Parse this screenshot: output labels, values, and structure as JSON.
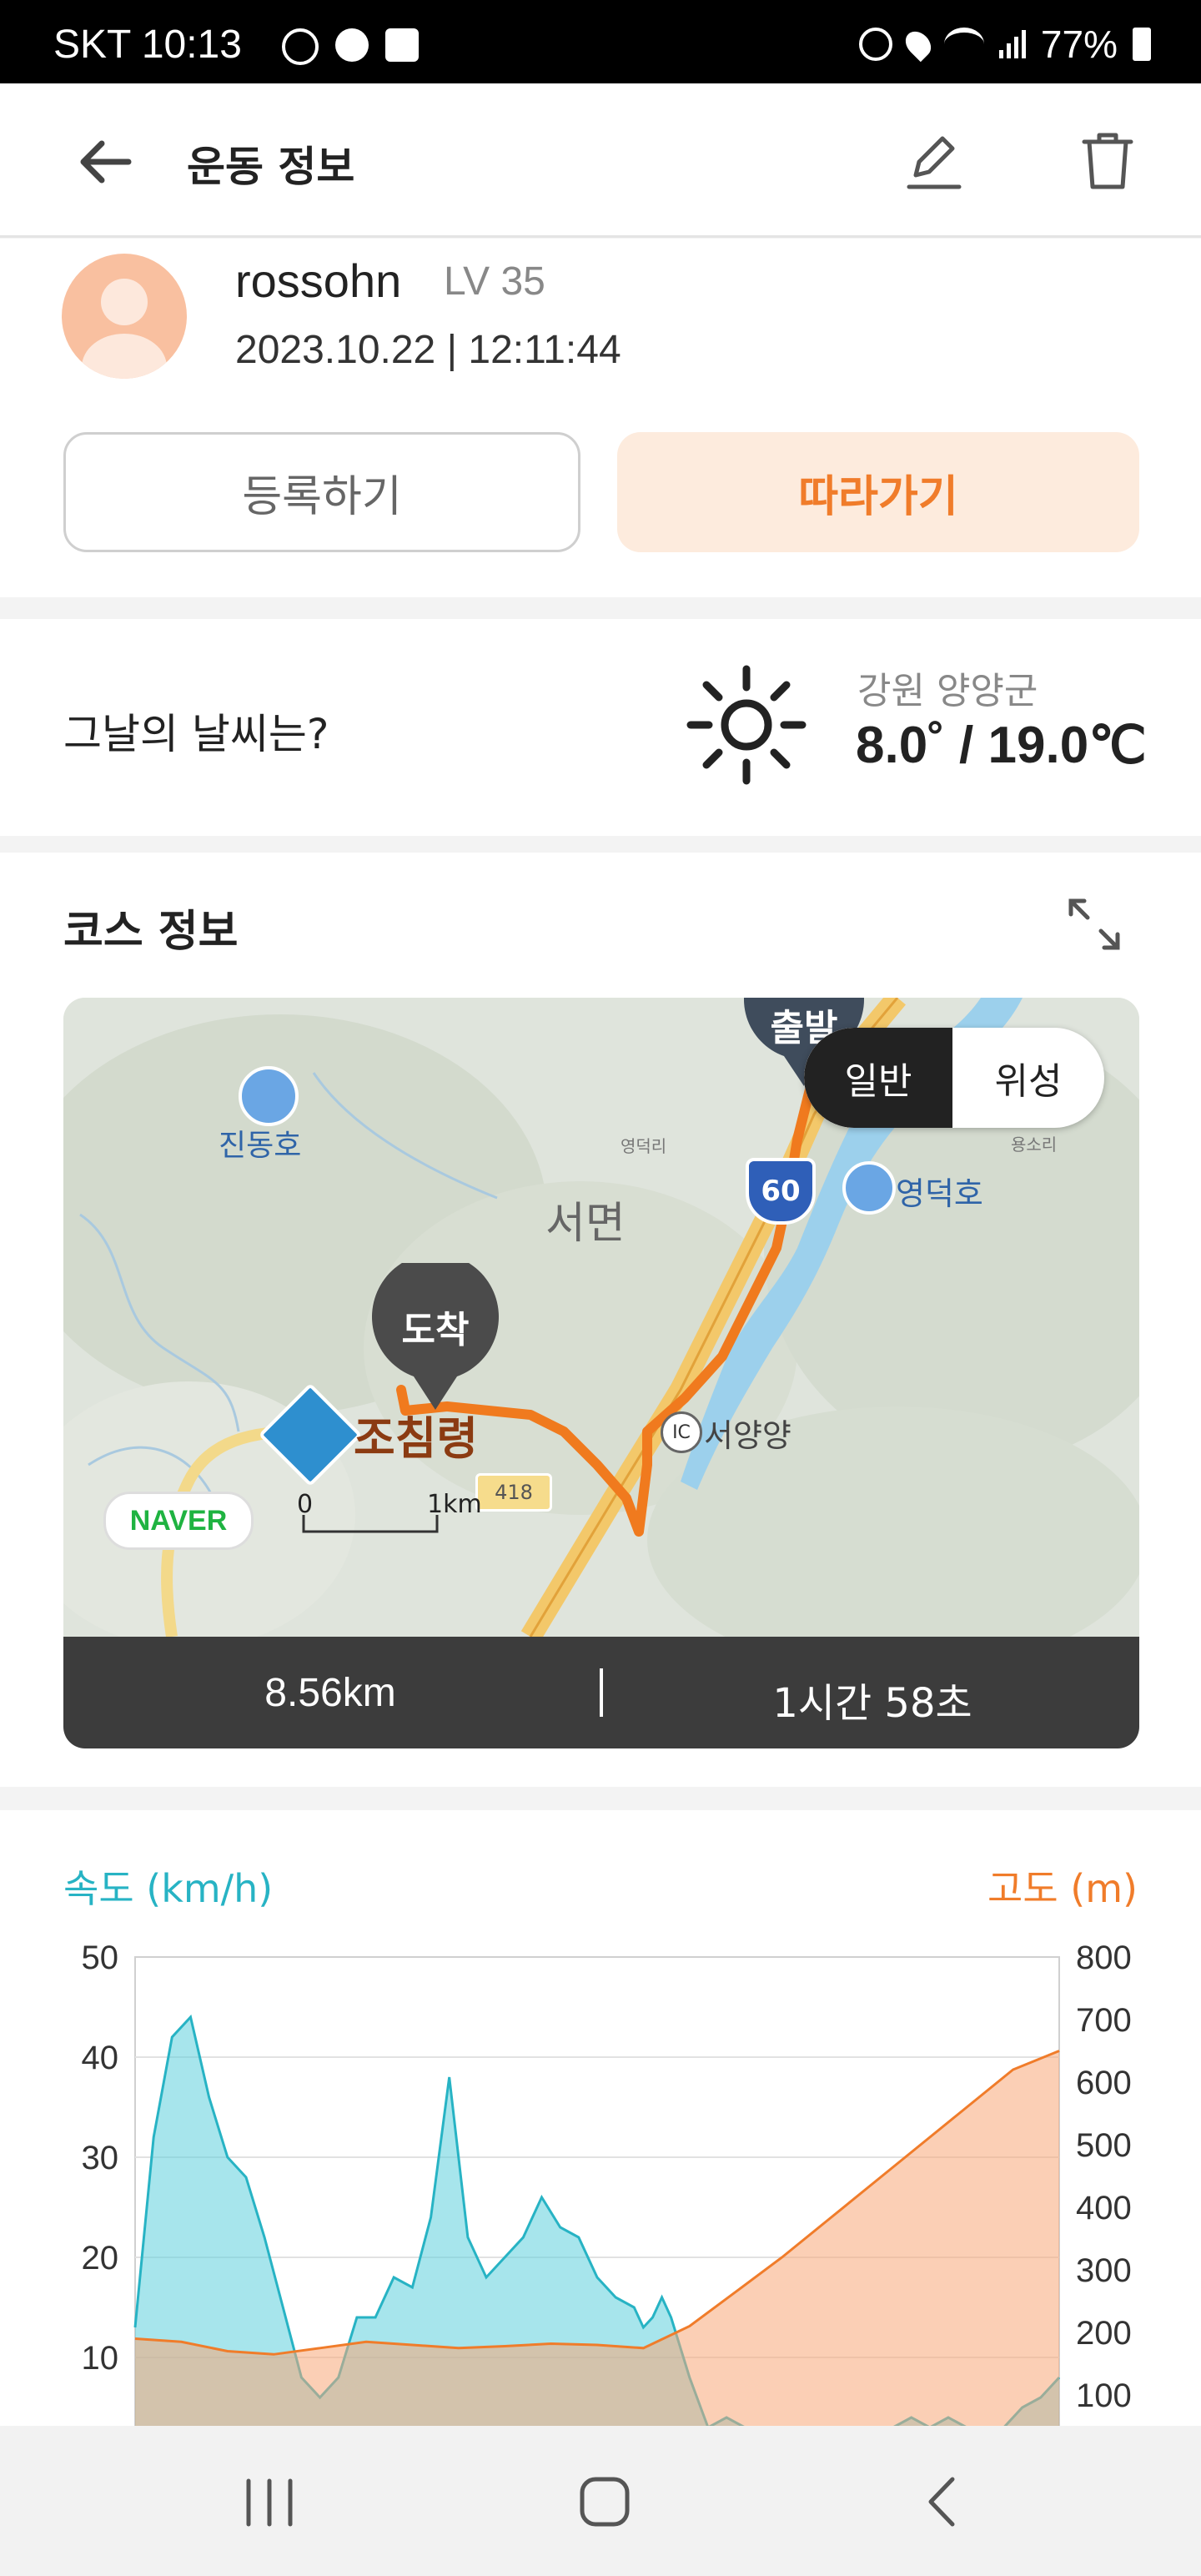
{
  "status_bar": {
    "carrier_time": "SKT 10:13",
    "battery": "77%"
  },
  "header": {
    "title": "운동 정보"
  },
  "profile": {
    "username": "rossohn",
    "level": "LV 35",
    "datetime": "2023.10.22 | 12:11:44",
    "register_label": "등록하기",
    "follow_label": "따라가기"
  },
  "weather": {
    "question": "그날의 날씨는?",
    "region": "강원 양양군",
    "temperature": "8.0˚ / 19.0℃"
  },
  "course": {
    "title": "코스 정보",
    "map_mode": {
      "normal": "일반",
      "satellite": "위성"
    },
    "labels": {
      "start": "출발",
      "arrive": "도착",
      "place_jochimryeong": "조침령",
      "place_seomyeon": "서면",
      "place_jindongho": "진동호",
      "place_yeongdeokho": "영덕호",
      "place_seoyangyang": "서양양",
      "place_yeongdeokri": "영덕리",
      "place_yongsori": "용소리",
      "road_shield": "60",
      "road_418": "418",
      "ic": "IC",
      "naver": "NAVER",
      "scale_zero": "0",
      "scale_km": "1km"
    },
    "distance": "8.56km",
    "duration": "1시간 58초"
  },
  "chart_data": {
    "type": "area",
    "title": "",
    "left_axis": {
      "label": "속도 (km/h)",
      "ticks": [
        "50",
        "40",
        "30",
        "20",
        "10"
      ],
      "range": [
        0,
        50
      ]
    },
    "right_axis": {
      "label": "고도 (m)",
      "ticks": [
        "800",
        "700",
        "600",
        "500",
        "400",
        "300",
        "200",
        "100"
      ],
      "range": [
        0,
        800
      ]
    },
    "series": [
      {
        "name": "속도 (km/h)",
        "color": "#27b3c4",
        "x": [
          0,
          2,
          4,
          6,
          8,
          10,
          12,
          14,
          16,
          18,
          20,
          22,
          24,
          25,
          26,
          28,
          30,
          32,
          34,
          36,
          38,
          40,
          42,
          44,
          46,
          48,
          50,
          52,
          54,
          55,
          56,
          57,
          58,
          60,
          62,
          64,
          66,
          68,
          70,
          72,
          74,
          76,
          78,
          80,
          82,
          84,
          86,
          88,
          90,
          92,
          94,
          96,
          98,
          100
        ],
        "values": [
          13,
          32,
          42,
          44,
          36,
          30,
          28,
          22,
          15,
          8,
          6,
          8,
          14,
          14,
          14,
          18,
          17,
          24,
          38,
          22,
          18,
          20,
          22,
          26,
          23,
          22,
          18,
          16,
          15,
          13,
          14,
          16,
          14,
          8,
          3,
          4,
          2,
          2,
          2,
          2,
          2,
          3,
          2,
          2,
          3,
          4,
          2,
          4,
          2,
          3,
          2,
          5,
          6,
          8
        ]
      },
      {
        "name": "고도 (m)",
        "color": "#f4a26e",
        "x": [
          0,
          5,
          10,
          15,
          20,
          25,
          30,
          35,
          40,
          45,
          50,
          55,
          60,
          65,
          70,
          75,
          80,
          85,
          90,
          95,
          100
        ],
        "values": [
          190,
          185,
          170,
          165,
          175,
          185,
          180,
          175,
          178,
          182,
          180,
          175,
          210,
          265,
          320,
          380,
          440,
          500,
          560,
          620,
          650
        ]
      }
    ]
  },
  "nav": {
    "recent": "recent-apps",
    "home": "home",
    "back": "back"
  }
}
